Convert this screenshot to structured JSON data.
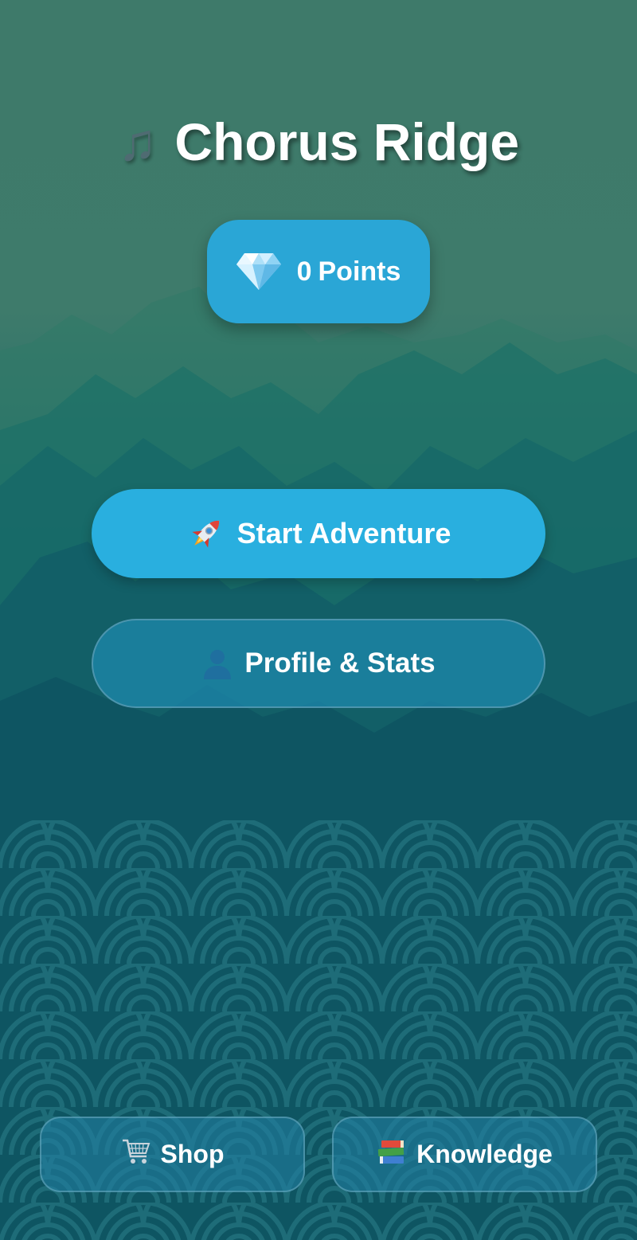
{
  "app": {
    "title": "Chorus Ridge",
    "title_icon": "music-note-icon",
    "title_icon_glyph": "♫"
  },
  "points": {
    "icon": "diamond-icon",
    "value": "0",
    "label": "Points"
  },
  "menu": {
    "start": {
      "label": "Start Adventure",
      "icon": "rocket-icon"
    },
    "profile": {
      "label": "Profile & Stats",
      "icon": "person-icon"
    }
  },
  "footer": {
    "shop": {
      "label": "Shop",
      "icon": "shopping-cart-icon"
    },
    "knowledge": {
      "label": "Knowledge",
      "icon": "books-icon"
    }
  },
  "colors": {
    "primary_button": "#29afdf",
    "badge": "#2aa6d6",
    "background_top": "#3e7a6a",
    "background_bottom": "#0a3f52"
  }
}
